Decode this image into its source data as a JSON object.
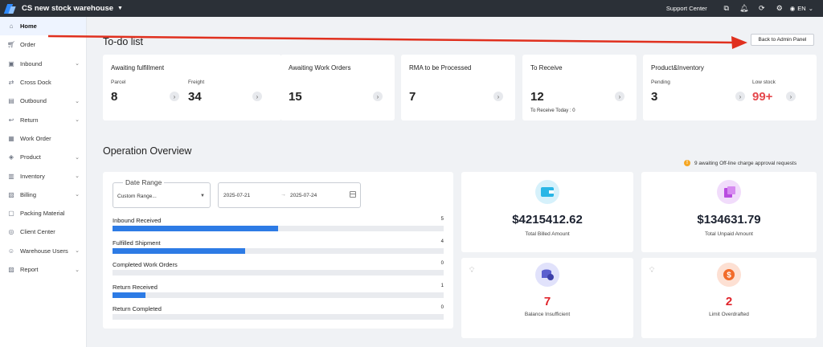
{
  "topbar": {
    "warehouse_name": "CS new stock warehouse",
    "support_label": "Support Center",
    "lang": "EN",
    "icons": [
      "open-external-icon",
      "bell-icon",
      "refresh-icon",
      "settings-icon",
      "user-icon"
    ]
  },
  "sidebar": {
    "items": [
      {
        "label": "Home",
        "icon": "home-icon",
        "chevron": false
      },
      {
        "label": "Order",
        "icon": "cart-icon",
        "chevron": false
      },
      {
        "label": "Inbound",
        "icon": "inbound-truck-icon",
        "chevron": true
      },
      {
        "label": "Cross Dock",
        "icon": "cross-dock-icon",
        "chevron": false
      },
      {
        "label": "Outbound",
        "icon": "outbound-box-icon",
        "chevron": true
      },
      {
        "label": "Return",
        "icon": "return-icon",
        "chevron": true
      },
      {
        "label": "Work Order",
        "icon": "work-order-icon",
        "chevron": false
      },
      {
        "label": "Product",
        "icon": "tag-icon",
        "chevron": true
      },
      {
        "label": "Inventory",
        "icon": "inventory-icon",
        "chevron": true
      },
      {
        "label": "Billing",
        "icon": "billing-icon",
        "chevron": true
      },
      {
        "label": "Packing Material",
        "icon": "package-icon",
        "chevron": false
      },
      {
        "label": "Client Center",
        "icon": "client-icon",
        "chevron": false
      },
      {
        "label": "Warehouse Users",
        "icon": "users-icon",
        "chevron": true
      },
      {
        "label": "Report",
        "icon": "report-icon",
        "chevron": true
      }
    ]
  },
  "todo": {
    "title": "To-do list",
    "admin_button": "Back to Admin Panel",
    "awaiting_fulfillment": {
      "title": "Awaiting fulfillment",
      "parcel_label": "Parcel",
      "parcel_value": "8",
      "freight_label": "Freight",
      "freight_value": "34"
    },
    "work_orders": {
      "title": "Awaiting Work Orders",
      "value": "15"
    },
    "rma": {
      "title": "RMA to be Processed",
      "value": "7"
    },
    "to_receive": {
      "title": "To Receive",
      "value": "12",
      "today_note": "To Receive Today : 0"
    },
    "product_inventory": {
      "title": "Product&Inventory",
      "pending_label": "Pending",
      "pending_value": "3",
      "low_stock_label": "Low stock",
      "low_stock_value": "99+"
    }
  },
  "overview": {
    "title": "Operation Overview",
    "notice": "9 awaiting Off-line charge approval requests",
    "date_range_legend": "Date Range",
    "date_range_value": "Custom Range...",
    "date_start": "2025-07-21",
    "date_sep": "→",
    "date_end": "2025-07-24",
    "bars": [
      {
        "label": "Inbound Received",
        "count": "5",
        "fraction": 0.5
      },
      {
        "label": "Fulfilled Shipment",
        "count": "4",
        "fraction": 0.4
      },
      {
        "label": "Completed Work Orders",
        "count": "0",
        "fraction": 0
      },
      {
        "label": "Return Received",
        "count": "1",
        "fraction": 0.1
      },
      {
        "label": "Return Completed",
        "count": "0",
        "fraction": 0
      }
    ],
    "stats": {
      "billed": {
        "value": "$4215412.62",
        "label": "Total Billed Amount",
        "color": "#29b6e6"
      },
      "unpaid": {
        "value": "$134631.79",
        "label": "Total Unpaid Amount",
        "color": "#b94be0"
      },
      "balance": {
        "value": "7",
        "label": "Balance Insufficient",
        "color": "#5b5fcf"
      },
      "overdraft": {
        "value": "2",
        "label": "Limit Overdrafted",
        "color": "#f26b2a"
      }
    }
  },
  "colors": {
    "accent": "#2d7be5",
    "topbar": "#2b3037",
    "alert": "#e0242b"
  }
}
